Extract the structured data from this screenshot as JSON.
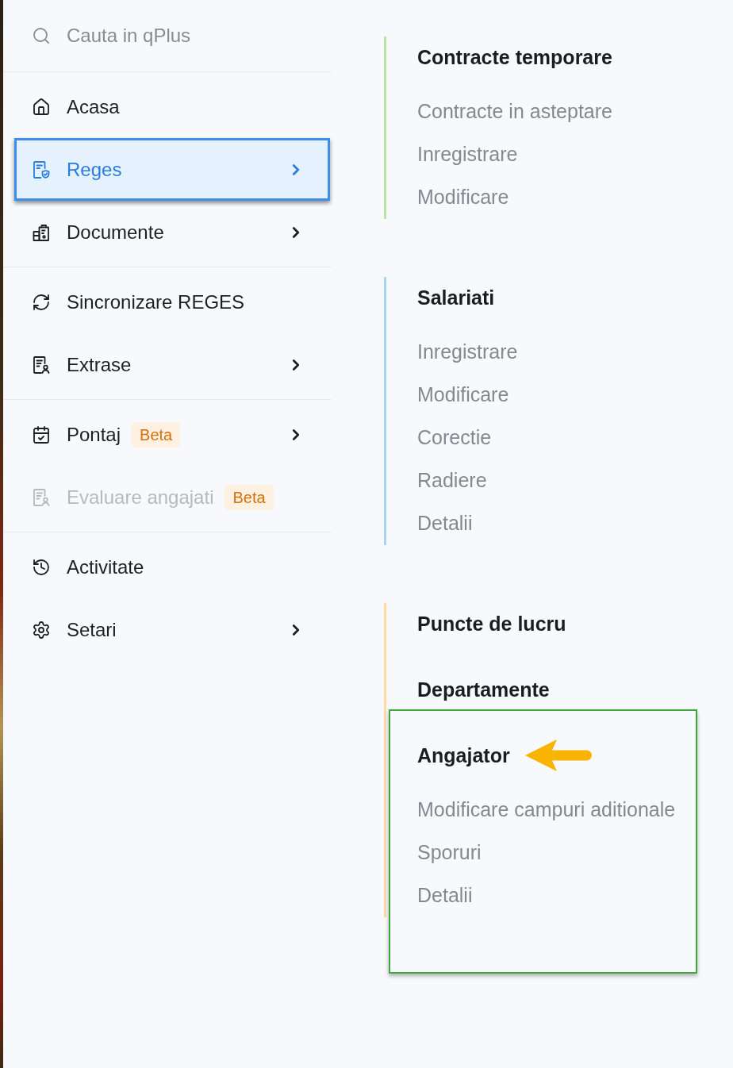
{
  "search": {
    "placeholder": "Cauta in qPlus"
  },
  "nav_sections": [
    {
      "items": [
        {
          "label": "Acasa",
          "selected": false,
          "outlined": false,
          "disabled": false,
          "has_submenu": false
        },
        {
          "label": "Reges",
          "selected": true,
          "outlined": true,
          "disabled": false,
          "has_submenu": true
        },
        {
          "label": "Documente",
          "selected": false,
          "outlined": false,
          "disabled": false,
          "has_submenu": true
        }
      ]
    },
    {
      "items": [
        {
          "label": "Sincronizare REGES",
          "selected": false,
          "outlined": false,
          "disabled": false,
          "has_submenu": false
        },
        {
          "label": "Extrase",
          "selected": false,
          "outlined": false,
          "disabled": false,
          "has_submenu": true
        }
      ]
    },
    {
      "items": [
        {
          "label": "Pontaj",
          "badge": "Beta",
          "selected": false,
          "outlined": false,
          "disabled": false,
          "has_submenu": true
        },
        {
          "label": "Evaluare angajati",
          "badge": "Beta",
          "selected": false,
          "outlined": false,
          "disabled": true,
          "has_submenu": false
        }
      ]
    },
    {
      "items": [
        {
          "label": "Activitate",
          "selected": false,
          "outlined": false,
          "disabled": false,
          "has_submenu": false
        },
        {
          "label": "Setari",
          "selected": false,
          "outlined": false,
          "disabled": false,
          "has_submenu": true
        }
      ]
    }
  ],
  "submenu": {
    "groups": [
      {
        "color": "#b8e4a1",
        "sections": [
          {
            "title": "Contracte temporare",
            "framed": false,
            "arrow": false,
            "items": [
              "Contracte in asteptare",
              "Inregistrare",
              "Modificare"
            ]
          }
        ]
      },
      {
        "color": "#a9d3f5",
        "sections": [
          {
            "title": "Salariati",
            "framed": false,
            "arrow": false,
            "items": [
              "Inregistrare",
              "Modificare",
              "Corectie",
              "Radiere",
              "Detalii"
            ]
          }
        ]
      },
      {
        "color": "#fbdba6",
        "sections": [
          {
            "title": "Puncte de lucru",
            "framed": false,
            "arrow": false
          },
          {
            "title": "Departamente",
            "framed": false,
            "arrow": false
          },
          {
            "title": "Angajator",
            "framed": true,
            "arrow": true,
            "items": [
              "Modificare campuri aditionale",
              "Sporuri",
              "Detalii"
            ]
          }
        ]
      }
    ]
  }
}
